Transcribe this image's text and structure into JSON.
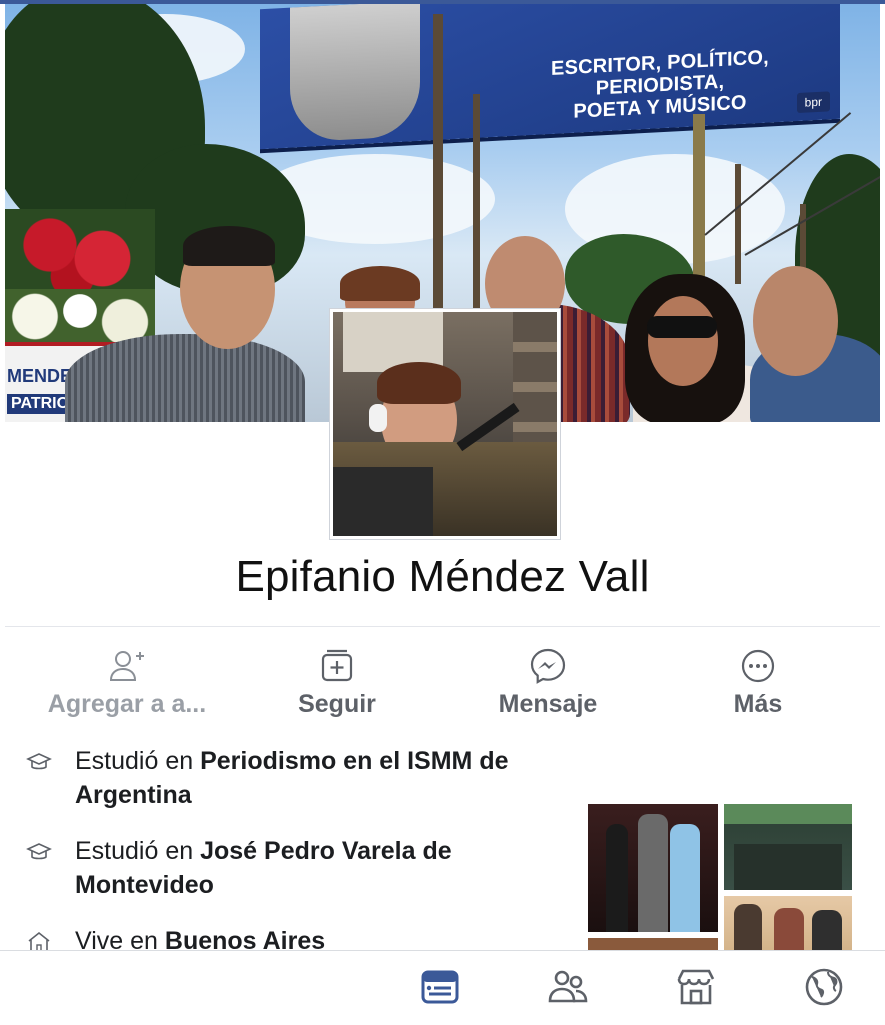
{
  "cover": {
    "billboard_text": [
      "ESCRITOR, POLÍTICO, PERIODISTA,",
      "POETA Y MÚSICO"
    ],
    "billboard_brand": "bpr",
    "banner_text": [
      "MENDEZ",
      "PATRIO"
    ]
  },
  "profile": {
    "name": "Epifanio Méndez Vall"
  },
  "actions": [
    {
      "label": "Agregar a a...",
      "icon": "add-friend-icon"
    },
    {
      "label": "Seguir",
      "icon": "follow-icon"
    },
    {
      "label": "Mensaje",
      "icon": "messenger-icon"
    },
    {
      "label": "Más",
      "icon": "more-icon"
    }
  ],
  "intro": [
    {
      "icon": "graduation-cap-icon",
      "prefix": "Estudió en ",
      "bold": "Periodismo en el ISMM de Argentina"
    },
    {
      "icon": "graduation-cap-icon",
      "prefix": "Estudió en ",
      "bold": "José Pedro Varela de Montevideo"
    },
    {
      "icon": "home-icon",
      "prefix": "Vive en ",
      "bold": "Buenos Aires"
    }
  ],
  "bottom_nav": [
    {
      "icon": "news-feed-icon",
      "active": true
    },
    {
      "icon": "friends-icon",
      "active": false
    },
    {
      "icon": "marketplace-icon",
      "active": false
    },
    {
      "icon": "globe-icon",
      "active": false
    }
  ],
  "colors": {
    "brand": "#3b5998",
    "text": "#1c1e21",
    "muted": "#5d6168",
    "muted_light": "#9a9fa6"
  }
}
